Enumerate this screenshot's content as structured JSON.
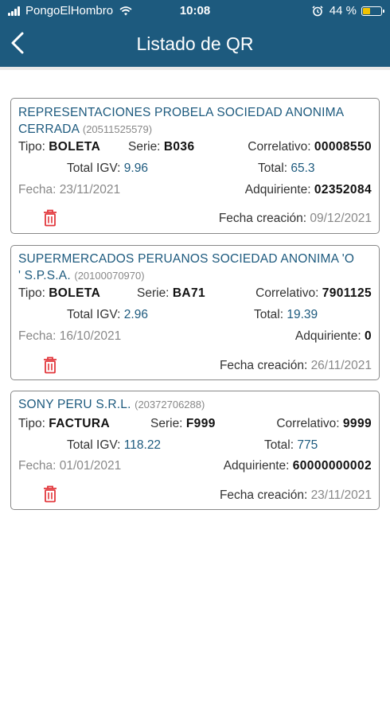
{
  "status_bar": {
    "carrier": "PongoElHombro",
    "time": "10:08",
    "battery": "44 %",
    "battery_level": 0.44
  },
  "header": {
    "title": "Listado de QR"
  },
  "colors": {
    "header_bg": "#1d5a7e",
    "accent": "#1d5a7e",
    "delete": "#e2373c"
  },
  "labels": {
    "tipo": "Tipo:",
    "serie": "Serie:",
    "correlativo": "Correlativo:",
    "total_igv": "Total IGV:",
    "total": "Total:",
    "fecha": "Fecha:",
    "adquiriente": "Adquiriente:",
    "fecha_creacion": "Fecha creación:"
  },
  "items": [
    {
      "company_line1": "REPRESENTACIONES PROBELA SOCIEDAD ANONIMA",
      "company_line2": "CERRADA",
      "ruc": "(20511525579)",
      "tipo": "BOLETA",
      "serie": "B036",
      "correlativo": "00008550",
      "total_igv": "9.96",
      "total": "65.3",
      "fecha": "23/11/2021",
      "adquiriente": "02352084",
      "fecha_creacion": "09/12/2021"
    },
    {
      "company_line1": "SUPERMERCADOS PERUANOS SOCIEDAD ANONIMA 'O",
      "company_line2": "' S.P.S.A.",
      "ruc": "(20100070970)",
      "tipo": "BOLETA",
      "serie": "BA71",
      "correlativo": "7901125",
      "total_igv": "2.96",
      "total": "19.39",
      "fecha": "16/10/2021",
      "adquiriente": "0",
      "fecha_creacion": "26/11/2021"
    },
    {
      "company_line1": "SONY PERU S.R.L.",
      "ruc": "(20372706288)",
      "tipo": "FACTURA",
      "serie": "F999",
      "correlativo": "9999",
      "total_igv": "118.22",
      "total": "775",
      "fecha": "01/01/2021",
      "adquiriente": "60000000002",
      "fecha_creacion": "23/11/2021"
    }
  ]
}
